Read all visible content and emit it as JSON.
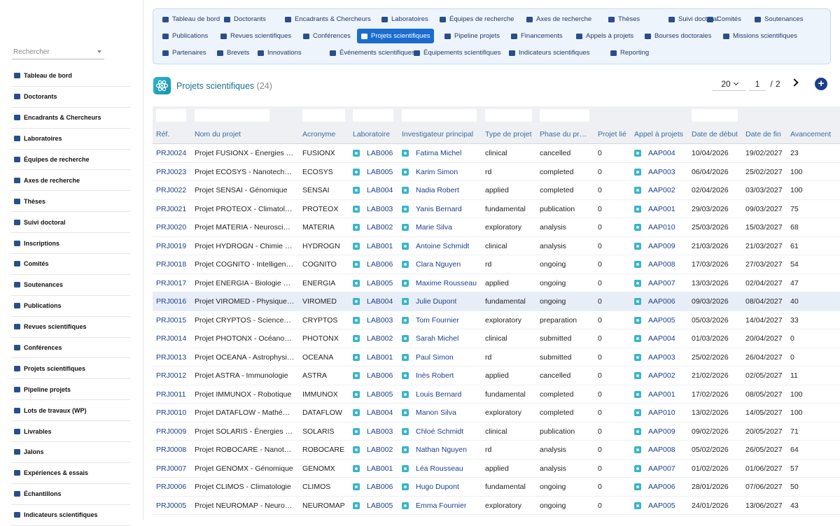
{
  "sidebar": {
    "search_placeholder": "Rechercher",
    "items": [
      {
        "label": "Tableau de bord",
        "icon": "dashboard-icon"
      },
      {
        "label": "Doctorants",
        "icon": "graduate-icon"
      },
      {
        "label": "Encadrants & Chercheurs",
        "icon": "teacher-icon"
      },
      {
        "label": "Laboratoires",
        "icon": "flask-icon"
      },
      {
        "label": "Équipes de recherche",
        "icon": "users-icon"
      },
      {
        "label": "Axes de recherche",
        "icon": "sitemap-icon"
      },
      {
        "label": "Thèses",
        "icon": "book-icon"
      },
      {
        "label": "Suivi doctoral",
        "icon": "clipboard-icon"
      },
      {
        "label": "Inscriptions",
        "icon": "id-card-icon"
      },
      {
        "label": "Comités",
        "icon": "users-icon"
      },
      {
        "label": "Soutenances",
        "icon": "presentation-icon"
      },
      {
        "label": "Publications",
        "icon": "open-book-icon"
      },
      {
        "label": "Revues scientifiques",
        "icon": "newspaper-icon"
      },
      {
        "label": "Conférences",
        "icon": "chalkboard-icon"
      },
      {
        "label": "Projets scientifiques",
        "icon": "project-diagram-icon"
      },
      {
        "label": "Pipeline projets",
        "icon": "list-icon"
      },
      {
        "label": "Lots de travaux (WP)",
        "icon": "tasks-icon"
      },
      {
        "label": "Livrables",
        "icon": "file-icon"
      },
      {
        "label": "Jalons",
        "icon": "flag-icon"
      },
      {
        "label": "Expériences & essais",
        "icon": "pen-icon"
      },
      {
        "label": "Échantillons",
        "icon": "vial-icon"
      },
      {
        "label": "Indicateurs scientifiques",
        "icon": "chart-icon"
      }
    ]
  },
  "topnav": {
    "rows": [
      [
        {
          "label": "Tableau de bord",
          "icon": "dashboard-icon"
        },
        {
          "label": "Doctorants",
          "icon": "graduate-icon"
        },
        {
          "label": "Encadrants & Chercheurs",
          "icon": "teacher-icon"
        },
        {
          "label": "Laboratoires",
          "icon": "flask-icon"
        },
        {
          "label": "Équipes de recherche",
          "icon": "users-icon"
        },
        {
          "label": "Axes de recherche",
          "icon": "sitemap-icon"
        },
        {
          "label": "Thèses",
          "icon": "book-icon"
        },
        {
          "label": "Suivi doctoral",
          "icon": "clipboard-icon"
        },
        {
          "label": "Comités",
          "icon": "users-icon"
        },
        {
          "label": "Soutenances",
          "icon": "presentation-icon"
        }
      ],
      [
        {
          "label": "Publications",
          "icon": "open-book-icon"
        },
        {
          "label": "Revues scientifiques",
          "icon": "newspaper-icon"
        },
        {
          "label": "Conférences",
          "icon": "chalkboard-icon"
        },
        {
          "label": "Projets scientifiques",
          "icon": "project-diagram-icon",
          "active": true
        },
        {
          "label": "Pipeline projets",
          "icon": "list-icon"
        },
        {
          "label": "Financements",
          "icon": "money-icon"
        },
        {
          "label": "Appels à projets",
          "icon": "megaphone-icon"
        },
        {
          "label": "Bourses doctorales",
          "icon": "hand-coin-icon"
        },
        {
          "label": "Missions scientifiques",
          "icon": "plane-icon"
        }
      ],
      [
        {
          "label": "Partenaires",
          "icon": "building-icon"
        },
        {
          "label": "Brevets",
          "icon": "certificate-icon"
        },
        {
          "label": "Innovations",
          "icon": "lightbulb-icon"
        },
        {
          "label": "Événements scientifiques",
          "icon": "calendar-icon"
        },
        {
          "label": "Équipements scientifiques",
          "icon": "microscope-icon"
        },
        {
          "label": "Indicateurs scientifiques",
          "icon": "chart-icon"
        },
        {
          "label": "Reporting",
          "icon": "pie-chart-icon"
        }
      ]
    ]
  },
  "page": {
    "title": "Projets scientifiques",
    "count": "(24)",
    "page_size": "20",
    "page_current": "1",
    "page_sep": "/",
    "page_total": "2"
  },
  "table": {
    "columns": [
      "Réf.",
      "Nom du projet",
      "Acronyme",
      "Laboratoire",
      "Investigateur principal",
      "Type de projet",
      "Phase du pr…",
      "Projet lié",
      "Appel à projets",
      "Date de début",
      "Date de fin",
      "Avancement"
    ],
    "rows": [
      [
        "PRJ0024",
        "Projet FUSIONX - Énergies …",
        "FUSIONX",
        "LAB006",
        "Fatima Michel",
        "clinical",
        "cancelled",
        "0",
        "AAP004",
        "10/04/2026",
        "19/02/2027",
        "23"
      ],
      [
        "PRJ0023",
        "Projet ECOSYS - Nanotech…",
        "ECOSYS",
        "LAB005",
        "Karim Simon",
        "rd",
        "completed",
        "0",
        "AAP003",
        "06/04/2026",
        "25/02/2027",
        "100"
      ],
      [
        "PRJ0022",
        "Projet SENSAI - Génomique",
        "SENSAI",
        "LAB004",
        "Nadia Robert",
        "applied",
        "completed",
        "0",
        "AAP002",
        "02/04/2026",
        "03/03/2027",
        "100"
      ],
      [
        "PRJ0021",
        "Projet PROTEOX - Climatol…",
        "PROTEOX",
        "LAB003",
        "Yanis Bernard",
        "fundamental",
        "publication",
        "0",
        "AAP001",
        "29/03/2026",
        "09/03/2027",
        "75"
      ],
      [
        "PRJ0020",
        "Projet MATERIA - Neurosci…",
        "MATERIA",
        "LAB002",
        "Marie Silva",
        "exploratory",
        "analysis",
        "0",
        "AAP010",
        "25/03/2026",
        "15/03/2027",
        "68"
      ],
      [
        "PRJ0019",
        "Projet HYDROGN - Chimie …",
        "HYDROGN",
        "LAB001",
        "Antoine Schmidt",
        "clinical",
        "analysis",
        "0",
        "AAP009",
        "21/03/2026",
        "21/03/2027",
        "61"
      ],
      [
        "PRJ0018",
        "Projet COGNITO - Intelligen…",
        "COGNITO",
        "LAB006",
        "Clara Nguyen",
        "rd",
        "ongoing",
        "0",
        "AAP008",
        "17/03/2026",
        "27/03/2027",
        "54"
      ],
      [
        "PRJ0017",
        "Projet ENERGIA - Biologie …",
        "ENERGIA",
        "LAB005",
        "Maxime Rousseau",
        "applied",
        "ongoing",
        "0",
        "AAP007",
        "13/03/2026",
        "02/04/2027",
        "47"
      ],
      [
        "PRJ0016",
        "Projet VIROMED - Physique…",
        "VIROMED",
        "LAB004",
        "Julie Dupont",
        "fundamental",
        "ongoing",
        "0",
        "AAP006",
        "09/03/2026",
        "08/04/2027",
        "40"
      ],
      [
        "PRJ0015",
        "Projet CRYPTOS - Science…",
        "CRYPTOS",
        "LAB003",
        "Tom Fournier",
        "exploratory",
        "preparation",
        "0",
        "AAP005",
        "05/03/2026",
        "14/04/2027",
        "33"
      ],
      [
        "PRJ0014",
        "Projet PHOTONX - Océano…",
        "PHOTONX",
        "LAB002",
        "Sarah Michel",
        "clinical",
        "submitted",
        "0",
        "AAP004",
        "01/03/2026",
        "20/04/2027",
        "0"
      ],
      [
        "PRJ0013",
        "Projet OCEANA - Astrophysi…",
        "OCEANA",
        "LAB001",
        "Paul Simon",
        "rd",
        "submitted",
        "0",
        "AAP003",
        "25/02/2026",
        "26/04/2027",
        "0"
      ],
      [
        "PRJ0012",
        "Projet ASTRA - Immunologie",
        "ASTRA",
        "LAB006",
        "Inès Robert",
        "applied",
        "cancelled",
        "0",
        "AAP002",
        "21/02/2026",
        "02/05/2027",
        "11"
      ],
      [
        "PRJ0011",
        "Projet IMMUNOX - Robotique",
        "IMMUNOX",
        "LAB005",
        "Louis Bernard",
        "fundamental",
        "completed",
        "0",
        "AAP001",
        "17/02/2026",
        "08/05/2027",
        "100"
      ],
      [
        "PRJ0010",
        "Projet DATAFLOW - Mathé…",
        "DATAFLOW",
        "LAB004",
        "Manon Silva",
        "exploratory",
        "completed",
        "0",
        "AAP010",
        "13/02/2026",
        "14/05/2027",
        "100"
      ],
      [
        "PRJ0009",
        "Projet SOLARIS - Énergies …",
        "SOLARIS",
        "LAB003",
        "Chloé Schmidt",
        "clinical",
        "publication",
        "0",
        "AAP009",
        "09/02/2026",
        "20/05/2027",
        "71"
      ],
      [
        "PRJ0008",
        "Projet ROBOCARE - Nanot…",
        "ROBOCARE",
        "LAB002",
        "Nathan Nguyen",
        "rd",
        "analysis",
        "0",
        "AAP008",
        "05/02/2026",
        "26/05/2027",
        "64"
      ],
      [
        "PRJ0007",
        "Projet GENOMX - Génomique",
        "GENOMX",
        "LAB001",
        "Léa Rousseau",
        "applied",
        "analysis",
        "0",
        "AAP007",
        "01/02/2026",
        "01/06/2027",
        "57"
      ],
      [
        "PRJ0006",
        "Projet CLIMOS - Climatologie",
        "CLIMOS",
        "LAB006",
        "Hugo Dupont",
        "fundamental",
        "ongoing",
        "0",
        "AAP006",
        "28/01/2026",
        "07/06/2027",
        "50"
      ],
      [
        "PRJ0005",
        "Projet NEUROMAP - Neuro…",
        "NEUROMAP",
        "LAB005",
        "Emma Fournier",
        "exploratory",
        "ongoing",
        "0",
        "AAP005",
        "24/01/2026",
        "13/06/2027",
        "43"
      ]
    ],
    "highlight_row": 8
  },
  "colors": {
    "accent": "#1a6dcf",
    "link": "#1d3f8c",
    "header_text": "#3c6aa0",
    "tag": "#3cb4c8"
  }
}
